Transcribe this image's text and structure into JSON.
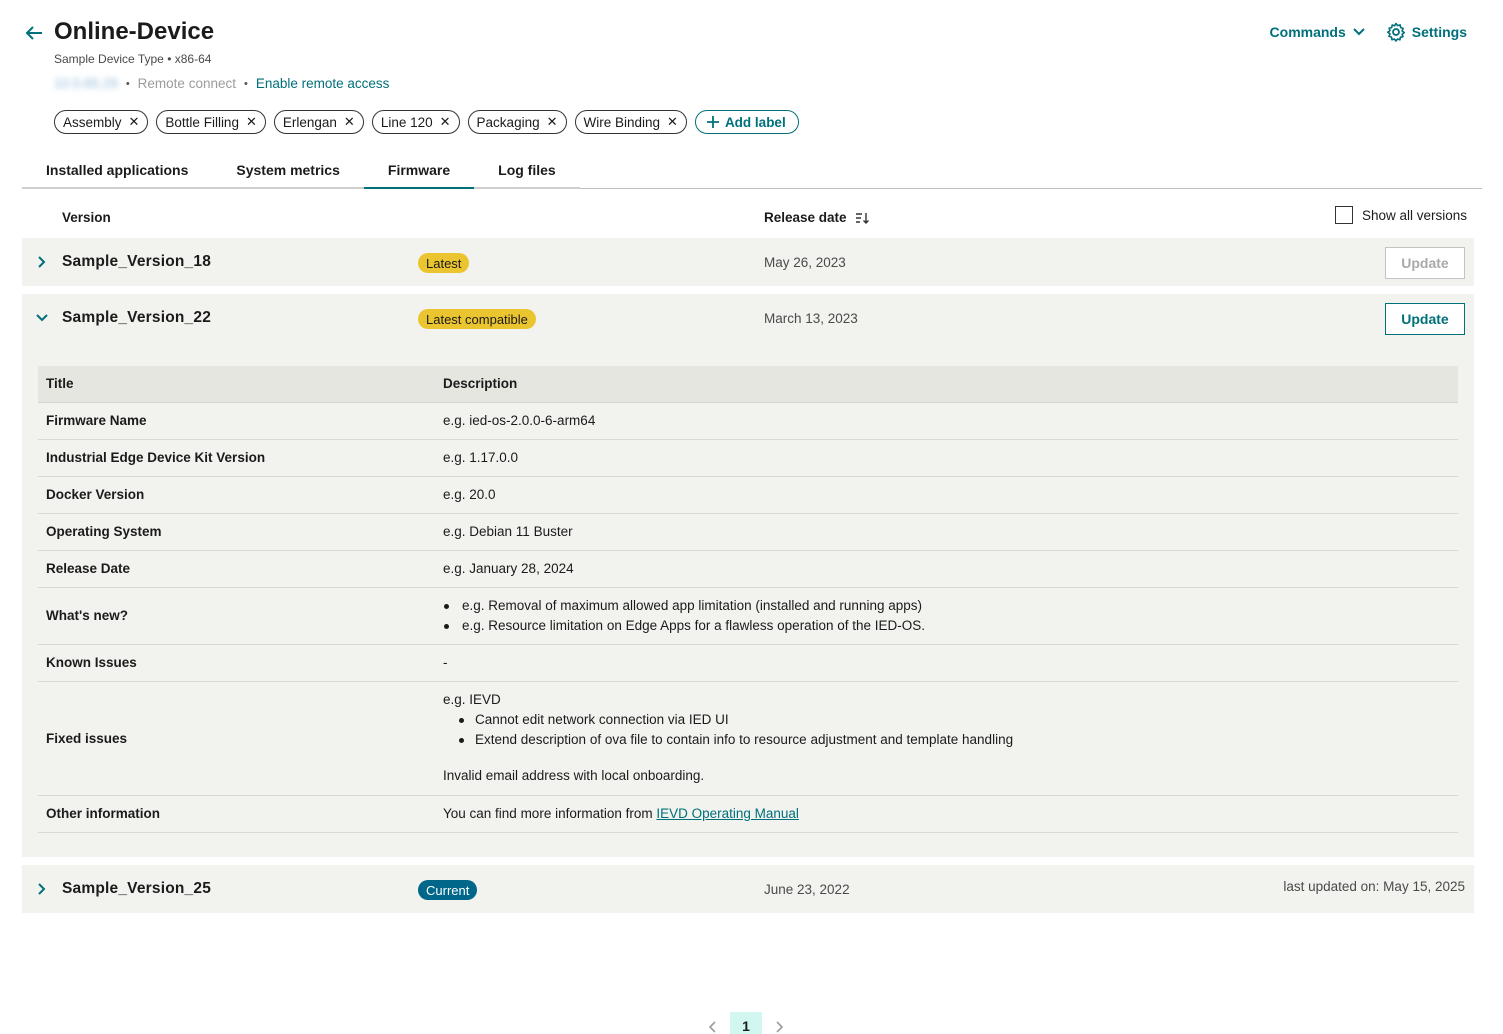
{
  "header": {
    "title": "Online-Device",
    "device_type": "Sample Device Type",
    "arch": "x86-64",
    "ip": "10.5.65.29",
    "remote_connect": "Remote connect",
    "enable_remote": "Enable remote access",
    "commands": "Commands",
    "settings": "Settings"
  },
  "labels": [
    "Assembly",
    "Bottle Filling",
    "Erlengan",
    "Line 120",
    "Packaging",
    "Wire Binding"
  ],
  "add_label": "Add label",
  "tabs": [
    "Installed applications",
    "System metrics",
    "Firmware",
    "Log files"
  ],
  "active_tab": "Firmware",
  "table": {
    "col_version": "Version",
    "col_release": "Release date",
    "show_all": "Show all versions"
  },
  "versions": [
    {
      "name": "Sample_Version_18",
      "badge": "Latest",
      "date": "May 26, 2023",
      "action": "Update"
    },
    {
      "name": "Sample_Version_22",
      "badge": "Latest compatible",
      "date": "March 13, 2023",
      "action": "Update"
    },
    {
      "name": "Sample_Version_25",
      "badge": "Current",
      "date": "June 23, 2022",
      "last_updated": "last updated on: May 15, 2025"
    }
  ],
  "details": {
    "head_title": "Title",
    "head_desc": "Description",
    "rows": [
      {
        "k": "Firmware Name",
        "v": "e.g. ied-os-2.0.0-6-arm64"
      },
      {
        "k": "Industrial Edge Device Kit Version",
        "v": "e.g. 1.17.0.0"
      },
      {
        "k": "Docker Version",
        "v": "e.g. 20.0"
      },
      {
        "k": "Operating System",
        "v": "e.g. Debian 11 Buster"
      },
      {
        "k": "Release Date",
        "v": "e.g. January 28, 2024"
      }
    ],
    "whats_new": {
      "k": "What's new?",
      "items": [
        "e.g. Removal of maximum allowed app limitation (installed and running apps)",
        "e.g. Resource limitation on Edge Apps for a flawless operation of the IED-OS."
      ]
    },
    "known_issues": {
      "k": "Known Issues",
      "v": "-"
    },
    "fixed_issues": {
      "k": "Fixed issues",
      "intro": "e.g. IEVD",
      "items": [
        "Cannot edit network connection via IED UI",
        "Extend description of ova file to contain info to resource adjustment and template handling"
      ],
      "outro": "Invalid email address with local onboarding."
    },
    "other": {
      "k": "Other information",
      "text": "You can find more information from ",
      "link": "IEVD Operating Manual"
    }
  },
  "pagination": {
    "page": "1"
  },
  "colors": {
    "accent": "#00707a",
    "badge_yellow": "#ebc52f",
    "badge_blue": "#00668a",
    "row_bg": "#f2f2ef"
  }
}
